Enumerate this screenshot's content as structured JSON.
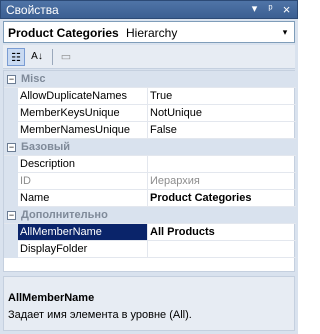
{
  "window": {
    "title": "Свойства",
    "buttons": {
      "dropdown": "▾",
      "pin": "ᵖ",
      "close": "×"
    }
  },
  "selector": {
    "object_name": "Product Categories",
    "object_type": "Hierarchy",
    "arrow": "▾"
  },
  "toolbar": {
    "categorized": "☷",
    "alphabetical": "A↓",
    "property_pages": "▭"
  },
  "grid": {
    "rows": [
      {
        "kind": "category",
        "toggle": "−",
        "name": "Misc"
      },
      {
        "kind": "prop",
        "name": "AllowDuplicateNames",
        "value": "True"
      },
      {
        "kind": "prop",
        "name": "MemberKeysUnique",
        "value": "NotUnique"
      },
      {
        "kind": "prop",
        "name": "MemberNamesUnique",
        "value": "False"
      },
      {
        "kind": "category",
        "toggle": "−",
        "name": "Базовый"
      },
      {
        "kind": "prop",
        "name": "Description",
        "value": ""
      },
      {
        "kind": "prop",
        "name": "ID",
        "value": "Иерархия",
        "disabled": true
      },
      {
        "kind": "prop",
        "name": "Name",
        "value": "Product Categories",
        "bold": true
      },
      {
        "kind": "category",
        "toggle": "−",
        "name": "Дополнительно"
      },
      {
        "kind": "prop",
        "name": "AllMemberName",
        "value": "All Products",
        "bold": true,
        "selected": true
      },
      {
        "kind": "prop",
        "name": "DisplayFolder",
        "value": ""
      }
    ]
  },
  "description": {
    "title": "AllMemberName",
    "text": "Задает имя элемента в уровне (All)."
  }
}
